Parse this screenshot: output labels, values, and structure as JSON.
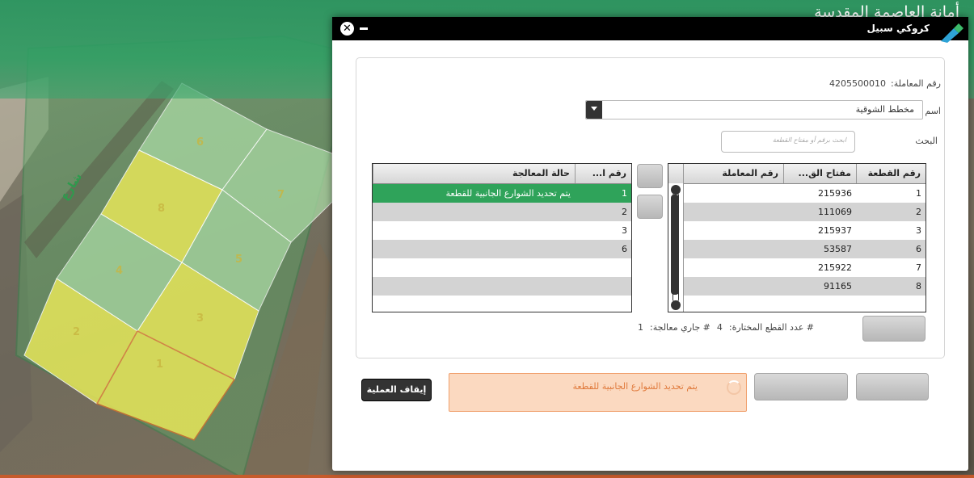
{
  "banner": {
    "title": "أمانة العاصمة المقدسة"
  },
  "dialog": {
    "title": "كروكي سبيل",
    "close_icon": "close-icon",
    "minimize_icon": "minimize-icon"
  },
  "form": {
    "transaction_label": "رقم المعاملة:",
    "transaction_value": "4205500010",
    "plan_label": "اسم المخطط",
    "plan_value": "مخطط الشوقية",
    "search_label": "البحث",
    "search_placeholder": "ابحث برقم أو مفتاح القطعة"
  },
  "left_table": {
    "headers": [
      "رقم القطعة",
      "مفتاح الق...",
      "رقم المعاملة"
    ],
    "rows": [
      {
        "plot": "1",
        "key": "215936",
        "txn": ""
      },
      {
        "plot": "2",
        "key": "111069",
        "txn": ""
      },
      {
        "plot": "3",
        "key": "215937",
        "txn": ""
      },
      {
        "plot": "6",
        "key": "53587",
        "txn": ""
      },
      {
        "plot": "7",
        "key": "215922",
        "txn": ""
      },
      {
        "plot": "8",
        "key": "91165",
        "txn": ""
      }
    ]
  },
  "right_table": {
    "headers": [
      "رقم ا...",
      "حالة المعالجة"
    ],
    "rows": [
      {
        "num": "1",
        "status": "يتم تحديد الشوارع الجانبية للقطعة",
        "selected": true
      },
      {
        "num": "2",
        "status": ""
      },
      {
        "num": "3",
        "status": ""
      },
      {
        "num": "6",
        "status": ""
      },
      {
        "num": "",
        "status": ""
      },
      {
        "num": "",
        "status": ""
      }
    ]
  },
  "counts": {
    "selected_label": "# عدد القطع المختارة:",
    "selected_value": "4",
    "processing_label": "# جاري معالجة:",
    "processing_value": "1"
  },
  "status": {
    "message": "يتم تحديد الشوارع الجانبية للقطعة"
  },
  "actions": {
    "stop_label": "إيقاف العملية"
  },
  "map": {
    "street_label": "شارع",
    "plot_numbers": [
      "6",
      "7",
      "8",
      "5",
      "4",
      "3",
      "2",
      "1"
    ]
  },
  "colors": {
    "header_green": "#2fa35a",
    "status_bg": "#fbd9c0",
    "status_text": "#e07a3c",
    "plot_yellow": "#e6e65a",
    "plot_green": "#a9d9a3"
  }
}
